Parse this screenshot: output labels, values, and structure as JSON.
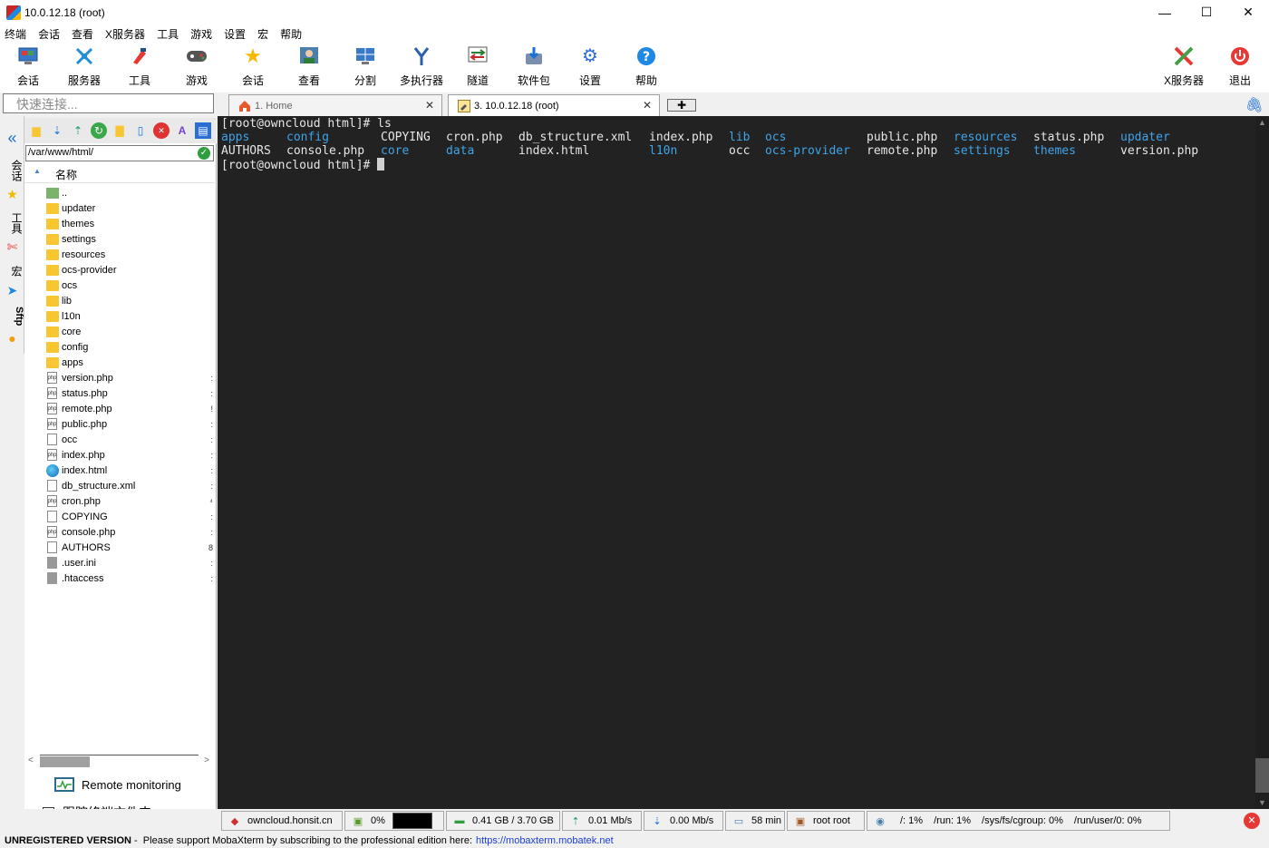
{
  "window": {
    "title": "10.0.12.18 (root)",
    "min": "—",
    "max": "☐",
    "close": "✕"
  },
  "menu": [
    "终端",
    "会话",
    "查看",
    "X服务器",
    "工具",
    "游戏",
    "设置",
    "宏",
    "帮助"
  ],
  "toolbar": {
    "left": [
      {
        "label": "会话",
        "icon": "session-icon"
      },
      {
        "label": "服务器",
        "icon": "servers-icon"
      },
      {
        "label": "工具",
        "icon": "tools-icon"
      },
      {
        "label": "游戏",
        "icon": "games-icon"
      },
      {
        "label": "会话",
        "icon": "star-icon"
      },
      {
        "label": "查看",
        "icon": "view-icon"
      },
      {
        "label": "分割",
        "icon": "split-icon"
      },
      {
        "label": "多执行器",
        "icon": "multiexec-icon"
      },
      {
        "label": "隧道",
        "icon": "tunnel-icon"
      },
      {
        "label": "软件包",
        "icon": "packages-icon"
      },
      {
        "label": "设置",
        "icon": "settings-icon"
      },
      {
        "label": "帮助",
        "icon": "help-icon"
      }
    ],
    "right": [
      {
        "label": "X服务器",
        "icon": "xserver-icon"
      },
      {
        "label": "退出",
        "icon": "exit-icon"
      }
    ]
  },
  "quick_connect": {
    "placeholder": "快速连接..."
  },
  "tabs": [
    {
      "label": "1. Home"
    },
    {
      "label": "3. 10.0.12.18 (root)"
    }
  ],
  "vstrip": {
    "sessions": "会话",
    "tools": "工具",
    "macros": "宏",
    "sftp": "Sftp"
  },
  "sidebar": {
    "path": "/var/www/html/",
    "column_name": "名称",
    "files": [
      {
        "name": "..",
        "type": "up"
      },
      {
        "name": "updater",
        "type": "folder"
      },
      {
        "name": "themes",
        "type": "folder"
      },
      {
        "name": "settings",
        "type": "folder"
      },
      {
        "name": "resources",
        "type": "folder"
      },
      {
        "name": "ocs-provider",
        "type": "folder"
      },
      {
        "name": "ocs",
        "type": "folder"
      },
      {
        "name": "lib",
        "type": "folder"
      },
      {
        "name": "l10n",
        "type": "folder"
      },
      {
        "name": "core",
        "type": "folder"
      },
      {
        "name": "config",
        "type": "folder"
      },
      {
        "name": "apps",
        "type": "folder"
      },
      {
        "name": "version.php",
        "type": "php",
        "cut": ":"
      },
      {
        "name": "status.php",
        "type": "php",
        "cut": ":"
      },
      {
        "name": "remote.php",
        "type": "php",
        "cut": "!"
      },
      {
        "name": "public.php",
        "type": "php",
        "cut": ":"
      },
      {
        "name": "occ",
        "type": "file",
        "cut": ":"
      },
      {
        "name": "index.php",
        "type": "php",
        "cut": ":"
      },
      {
        "name": "index.html",
        "type": "html",
        "cut": ":"
      },
      {
        "name": "db_structure.xml",
        "type": "file",
        "cut": ":"
      },
      {
        "name": "cron.php",
        "type": "php",
        "cut": "⁴"
      },
      {
        "name": "COPYING",
        "type": "file",
        "cut": ":"
      },
      {
        "name": "console.php",
        "type": "php",
        "cut": ":"
      },
      {
        "name": "AUTHORS",
        "type": "file",
        "cut": "8"
      },
      {
        "name": ".user.ini",
        "type": "grey",
        "cut": ":"
      },
      {
        "name": ".htaccess",
        "type": "grey",
        "cut": ":"
      }
    ],
    "remote_monitoring": "Remote monitoring",
    "follow_terminal": "跟踪终端文件夹",
    "follow_checked": "✓"
  },
  "terminal": {
    "prompt1": "[root@owncloud html]# ls",
    "row1": [
      {
        "text": "apps",
        "dir": true
      },
      {
        "text": "config",
        "dir": true
      },
      {
        "text": "COPYING",
        "dir": false
      },
      {
        "text": "cron.php",
        "dir": false
      },
      {
        "text": "db_structure.xml",
        "dir": false
      },
      {
        "text": "index.php",
        "dir": false
      },
      {
        "text": "lib",
        "dir": true
      },
      {
        "text": "ocs",
        "dir": true
      },
      {
        "text": "public.php",
        "dir": false
      },
      {
        "text": "resources",
        "dir": true
      },
      {
        "text": "status.php",
        "dir": false
      },
      {
        "text": "updater",
        "dir": true
      }
    ],
    "row2": [
      {
        "text": "AUTHORS",
        "dir": false
      },
      {
        "text": "console.php",
        "dir": false
      },
      {
        "text": "core",
        "dir": true
      },
      {
        "text": "data",
        "dir": true
      },
      {
        "text": "index.html",
        "dir": false
      },
      {
        "text": "l10n",
        "dir": true
      },
      {
        "text": "occ",
        "dir": false
      },
      {
        "text": "ocs-provider",
        "dir": true
      },
      {
        "text": "remote.php",
        "dir": false
      },
      {
        "text": "settings",
        "dir": true
      },
      {
        "text": "themes",
        "dir": true
      },
      {
        "text": "version.php",
        "dir": false
      }
    ],
    "prompt2": "[root@owncloud html]# "
  },
  "status": {
    "host": "owncloud.honsit.cn",
    "cpu": "0%",
    "memory": "0.41 GB / 3.70 GB",
    "upload": "0.01 Mb/s",
    "download": "0.00 Mb/s",
    "uptime": "58 min",
    "user": "root root",
    "disk_root": "/: 1%",
    "disk_run": "/run: 1%",
    "disk_cgroup": "/sys/fs/cgroup: 0%",
    "disk_user": "/run/user/0: 0%"
  },
  "footer": {
    "unregistered": "UNREGISTERED VERSION",
    "message": " -  Please support MobaXterm by subscribing to the professional edition here:",
    "link": "https://mobaxterm.mobatek.net"
  },
  "colors": {
    "terminal_bg": "#222222",
    "dir": "#3fa4e8",
    "folder": "#f8c630"
  }
}
